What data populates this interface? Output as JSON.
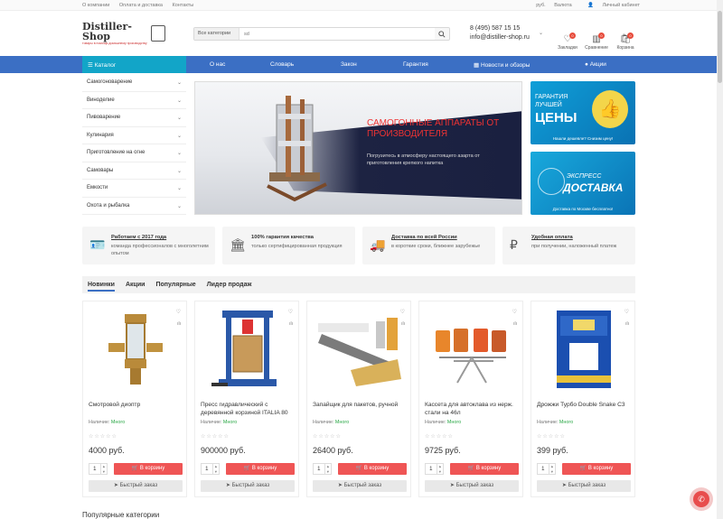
{
  "topbar": {
    "links": [
      "О компании",
      "Оплата и доставка",
      "Контакты"
    ],
    "currency": "руб.",
    "currency_label": "Валюта",
    "account": "Личный кабинет"
  },
  "header": {
    "logo_title": "Distiller-Shop",
    "logo_sub": "товары в помощь домашнему производству",
    "search_category": "Все категории",
    "search_placeholder": "sd",
    "phone": "8 (495) 587 15 15",
    "email": "info@distiller-shop.ru",
    "icons": [
      {
        "label": "Закладки",
        "badge": "0",
        "icon": "heart-icon"
      },
      {
        "label": "Сравнение",
        "badge": "0",
        "icon": "compare-icon"
      },
      {
        "label": "Корзина",
        "badge": "0",
        "icon": "cart-icon"
      }
    ]
  },
  "nav": {
    "catalog": "Каталог",
    "items": [
      "О нас",
      "Словарь",
      "Закон",
      "Гарантия",
      "Новости и обзоры",
      "Акции"
    ]
  },
  "sidebar": [
    "Самогоноварение",
    "Виноделие",
    "Пивоварение",
    "Кулинария",
    "Приготовление на огне",
    "Самовары",
    "Емкости",
    "Охота и рыбалка"
  ],
  "banner": {
    "title": "САМОГОННЫЕ АППАРАТЫ ОТ ПРОИЗВОДИТЕЛЯ",
    "text": "Погрузитесь в атмосферу настоящего азарта от приготовления крепкого напитка"
  },
  "promo1": {
    "line1": "ГАРАНТИЯ",
    "line2": "ЛУЧШЕЙ",
    "big": "ЦЕНЫ",
    "sub": "Нашли дешевле? Снизим цену!"
  },
  "promo2": {
    "line1": "ЭКСПРЕСС",
    "big": "ДОСТАВКА",
    "sub": "Доставка по Москве бесплатно!"
  },
  "features": [
    {
      "title": "Работаем с 2017 года",
      "desc": "команда профессионалов с многолетним опытом",
      "icon": "id-card-icon"
    },
    {
      "title": "100% гарантия качества",
      "desc": "только сертифицированная продукция",
      "icon": "bank-icon"
    },
    {
      "title": "Доставка по всей России",
      "desc": "в короткие сроки, ближнее зарубежье",
      "icon": "truck-icon"
    },
    {
      "title": "Удобная оплата",
      "desc": "при получении, наложенный платеж",
      "icon": "ruble-icon"
    }
  ],
  "tabs": [
    "Новинки",
    "Акции",
    "Популярные",
    "Лидер продаж"
  ],
  "product_labels": {
    "stock": "Наличие:",
    "stock_value": "Много",
    "cart": "В корзину",
    "quick": "Быстрый заказ",
    "qty": "1"
  },
  "products": [
    {
      "name": "Смотровой диоптр",
      "price": "4000 руб."
    },
    {
      "name": "Пресс гидравлический с деревянной корзиной ITALIA 80",
      "price": "900000 руб."
    },
    {
      "name": "Запайщик для пакетов, ручной",
      "price": "26400 руб."
    },
    {
      "name": "Кассета для автоклава из нерж. стали на 46л",
      "price": "9725 руб."
    },
    {
      "name": "Дрожжи Турбо Double Snake C3",
      "price": "399 руб."
    }
  ],
  "section_title": "Популярные категории"
}
